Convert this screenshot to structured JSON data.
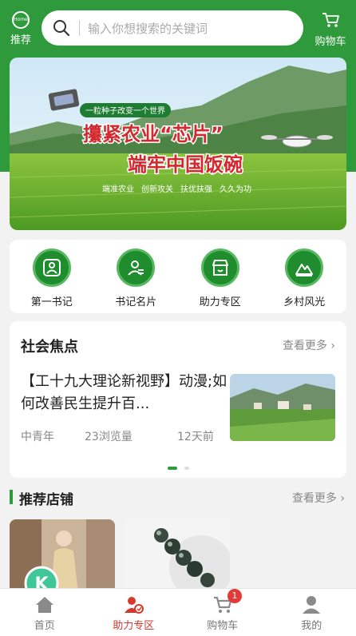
{
  "header": {
    "recommend_label": "推荐",
    "recommend_icon_text": "Home",
    "search_placeholder": "输入你想搜索的关键词",
    "cart_label": "购物车"
  },
  "banner": {
    "tagline": "一粒种子改变一个世界",
    "headline_1": "攥紧农业“芯片”",
    "headline_2": "端牢中国饭碗",
    "slogans": [
      "端准农业",
      "创新攻关",
      "扶优扶强",
      "久久为功"
    ]
  },
  "quick_menu": [
    {
      "label": "第一书记",
      "icon": "user-badge-icon"
    },
    {
      "label": "书记名片",
      "icon": "card-icon"
    },
    {
      "label": "助力专区",
      "icon": "shop-icon"
    },
    {
      "label": "乡村风光",
      "icon": "mountain-icon"
    }
  ],
  "news": {
    "section_title": "社会焦点",
    "more_label": "查看更多",
    "headline": "【工十九大理论新视野】动漫;如何改善民生提升百...",
    "source": "中青年",
    "views": "23浏览量",
    "time": "12天前"
  },
  "shops": {
    "section_title": "推荐店铺",
    "more_label": "查看更多",
    "shop1_initial": "K"
  },
  "tabs": [
    {
      "label": "首页",
      "icon": "home-icon"
    },
    {
      "label": "助力专区",
      "icon": "help-zone-icon"
    },
    {
      "label": "购物车",
      "icon": "cart-icon"
    },
    {
      "label": "我的",
      "icon": "user-icon"
    }
  ],
  "cart_badge": "1",
  "colors": {
    "brand": "#2e9a3c",
    "active_tab": "#d33a2c",
    "badge": "#e53935"
  }
}
